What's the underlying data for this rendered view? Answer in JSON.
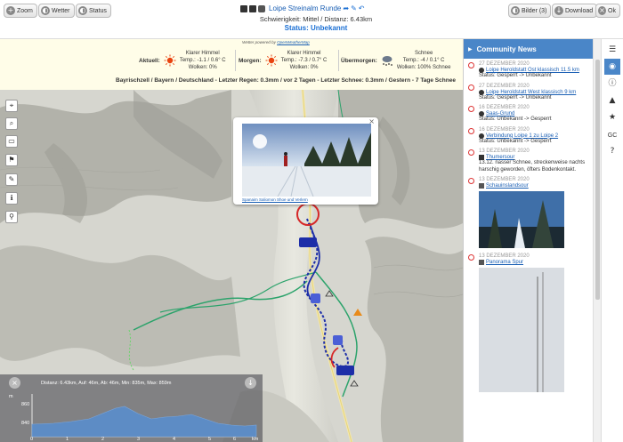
{
  "toolbar": {
    "zoom_label": "Zoom",
    "weather_label": "Wetter",
    "status_label": "Status",
    "pictures_label": "Bilder (3)",
    "download_label": "Download",
    "ok_label": "Ok"
  },
  "route": {
    "title": "Loipe Streinalm Runde",
    "difficulty": "Schwierigkeit: Mittel / Distanz: 6.43km",
    "status": "Status: Unbekannt"
  },
  "weather": {
    "powered_prefix": "Wetter powered by",
    "powered_link": "OpenWeatherMap",
    "current": {
      "label": "Aktuell:",
      "desc": "Klarer Himmel",
      "temp": "Temp.: -1.1 / 0.6° C",
      "clouds": "Wolken: 0%"
    },
    "tomorrow": {
      "label": "Morgen:",
      "desc": "Klarer Himmel",
      "temp": "Temp.: -7.3 / 0.7° C",
      "clouds": "Wolken: 0%"
    },
    "dayafter": {
      "label": "Übermorgen:",
      "desc": "Schnee",
      "temp": "Temp.: -4 / 0.1° C",
      "clouds": "Wolken: 100%  Schnee"
    },
    "region": "Bayrischzell / Bayern / Deutschland - Letzter Regen: 0.3mm / vor 2 Tagen - Letzter Schnee: 0.3mm / Gestern - 7 Tage Schnee"
  },
  "map": {
    "popup_caption": "Spanaim Saliomon Shoe und Verlern",
    "elevation_caption": "Distanz: 6.43km, Auf: 46m, Ab: 46m, Min: 835m, Max: 859m",
    "y_unit": "m",
    "y_ticks": [
      "860",
      "840"
    ],
    "x_ticks": [
      "0",
      "1",
      "2",
      "3",
      "4",
      "5",
      "6"
    ],
    "x_unit": "km"
  },
  "news": {
    "title": "Community News",
    "items": [
      {
        "date": "27 DEZEMBER 2020",
        "link": "Loipe Heroldstatt Ost klassisch 11.5 km",
        "status": "Status: Gesperrt -> Unbekannt"
      },
      {
        "date": "27 DEZEMBER 2020",
        "link": "Loipe Heroldstatt West klassisch 9 km",
        "status": "Status: Gesperrt -> Unbekannt"
      },
      {
        "date": "16 DEZEMBER 2020",
        "link": "Saas-Grund",
        "status": "Status: Unbekannt -> Gesperrt"
      },
      {
        "date": "16 DEZEMBER 2020",
        "link": "Verbindung Loipe 1 zu Loipe 2",
        "status": "Status: Unbekannt -> Gesperrt"
      },
      {
        "date": "13 DEZEMBER 2020",
        "link": "Thumersour",
        "status": "13.12. nasser Schnee, streckenweise nachts harschig geworden, öfters Bodenkontakt."
      },
      {
        "date": "13 DEZEMBER 2020",
        "link": "Schauinslandsour",
        "status": ""
      },
      {
        "date": "13 DEZEMBER 2020",
        "link": "Panorama Spur",
        "status": ""
      }
    ]
  },
  "rail": {
    "gc_label": "GC"
  }
}
